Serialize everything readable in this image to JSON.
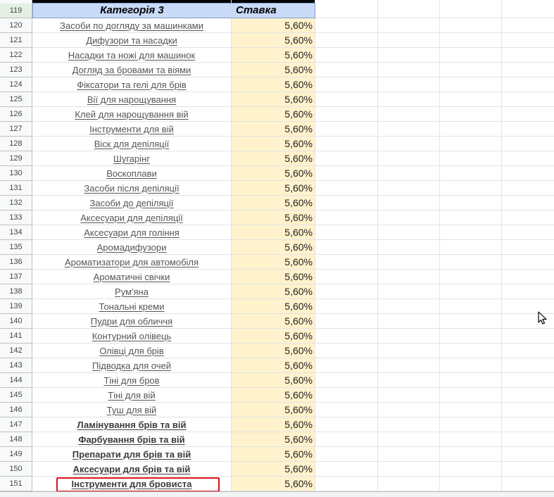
{
  "sheet": {
    "header": {
      "row_number": "119",
      "category_label": "Категорія 3",
      "rate_label": "Ставка"
    },
    "rows": [
      {
        "row": "120",
        "category": "Засоби по догляду за машинками",
        "rate": "5,60%",
        "bold": false
      },
      {
        "row": "121",
        "category": "Дифузори та насадки",
        "rate": "5,60%",
        "bold": false
      },
      {
        "row": "122",
        "category": "Насадки та ножі для машинок",
        "rate": "5,60%",
        "bold": false
      },
      {
        "row": "123",
        "category": "Догляд за бровами та віями",
        "rate": "5,60%",
        "bold": false
      },
      {
        "row": "124",
        "category": "Фіксатори та гелі для брів",
        "rate": "5,60%",
        "bold": false
      },
      {
        "row": "125",
        "category": "Вії для нарощування",
        "rate": "5,60%",
        "bold": false
      },
      {
        "row": "126",
        "category": "Клей для нарощування вій",
        "rate": "5,60%",
        "bold": false
      },
      {
        "row": "127",
        "category": "Інструменти для вій",
        "rate": "5,60%",
        "bold": false
      },
      {
        "row": "128",
        "category": "Віск для депіляції",
        "rate": "5,60%",
        "bold": false
      },
      {
        "row": "129",
        "category": "Шугарінг",
        "rate": "5,60%",
        "bold": false
      },
      {
        "row": "130",
        "category": "Воскоплави",
        "rate": "5,60%",
        "bold": false
      },
      {
        "row": "131",
        "category": "Засоби після депіляції",
        "rate": "5,60%",
        "bold": false
      },
      {
        "row": "132",
        "category": "Засоби до депіляції",
        "rate": "5,60%",
        "bold": false
      },
      {
        "row": "133",
        "category": "Аксесуари для депіляції",
        "rate": "5,60%",
        "bold": false
      },
      {
        "row": "134",
        "category": "Аксесуари для гоління",
        "rate": "5,60%",
        "bold": false
      },
      {
        "row": "135",
        "category": "Аромадифузори",
        "rate": "5,60%",
        "bold": false
      },
      {
        "row": "136",
        "category": "Ароматизатори для автомобіля",
        "rate": "5,60%",
        "bold": false
      },
      {
        "row": "137",
        "category": "Ароматичні свічки",
        "rate": "5,60%",
        "bold": false
      },
      {
        "row": "138",
        "category": "Рум'яна",
        "rate": "5,60%",
        "bold": false
      },
      {
        "row": "139",
        "category": "Тональні креми",
        "rate": "5,60%",
        "bold": false
      },
      {
        "row": "140",
        "category": "Пудри для обличчя",
        "rate": "5,60%",
        "bold": false
      },
      {
        "row": "141",
        "category": "Контурний олівець",
        "rate": "5,60%",
        "bold": false
      },
      {
        "row": "142",
        "category": "Олівці для брів",
        "rate": "5,60%",
        "bold": false
      },
      {
        "row": "143",
        "category": "Підводка для очей",
        "rate": "5,60%",
        "bold": false
      },
      {
        "row": "144",
        "category": "Тіні для бров",
        "rate": "5,60%",
        "bold": false
      },
      {
        "row": "145",
        "category": "Тіні для вій",
        "rate": "5,60%",
        "bold": false
      },
      {
        "row": "146",
        "category": "Туш для вій",
        "rate": "5,60%",
        "bold": false
      },
      {
        "row": "147",
        "category": "Ламінування брів та вій",
        "rate": "5,60%",
        "bold": true
      },
      {
        "row": "148",
        "category": "Фарбування брів та вій",
        "rate": "5,60%",
        "bold": true
      },
      {
        "row": "149",
        "category": "Препарати для брів та вій",
        "rate": "5,60%",
        "bold": true
      },
      {
        "row": "150",
        "category": "Аксесуари для брів та вій",
        "rate": "5,60%",
        "bold": true
      },
      {
        "row": "151",
        "category": "Інструменти для бровиста",
        "rate": "5,60%",
        "bold": true
      }
    ],
    "colors": {
      "header_bg": "#c9daf8",
      "rate_bg": "#fff2cc",
      "highlight_border": "#d9141b",
      "gridline": "#e2e3e3"
    },
    "icons": {
      "cursor": "mouse-pointer-icon"
    }
  }
}
